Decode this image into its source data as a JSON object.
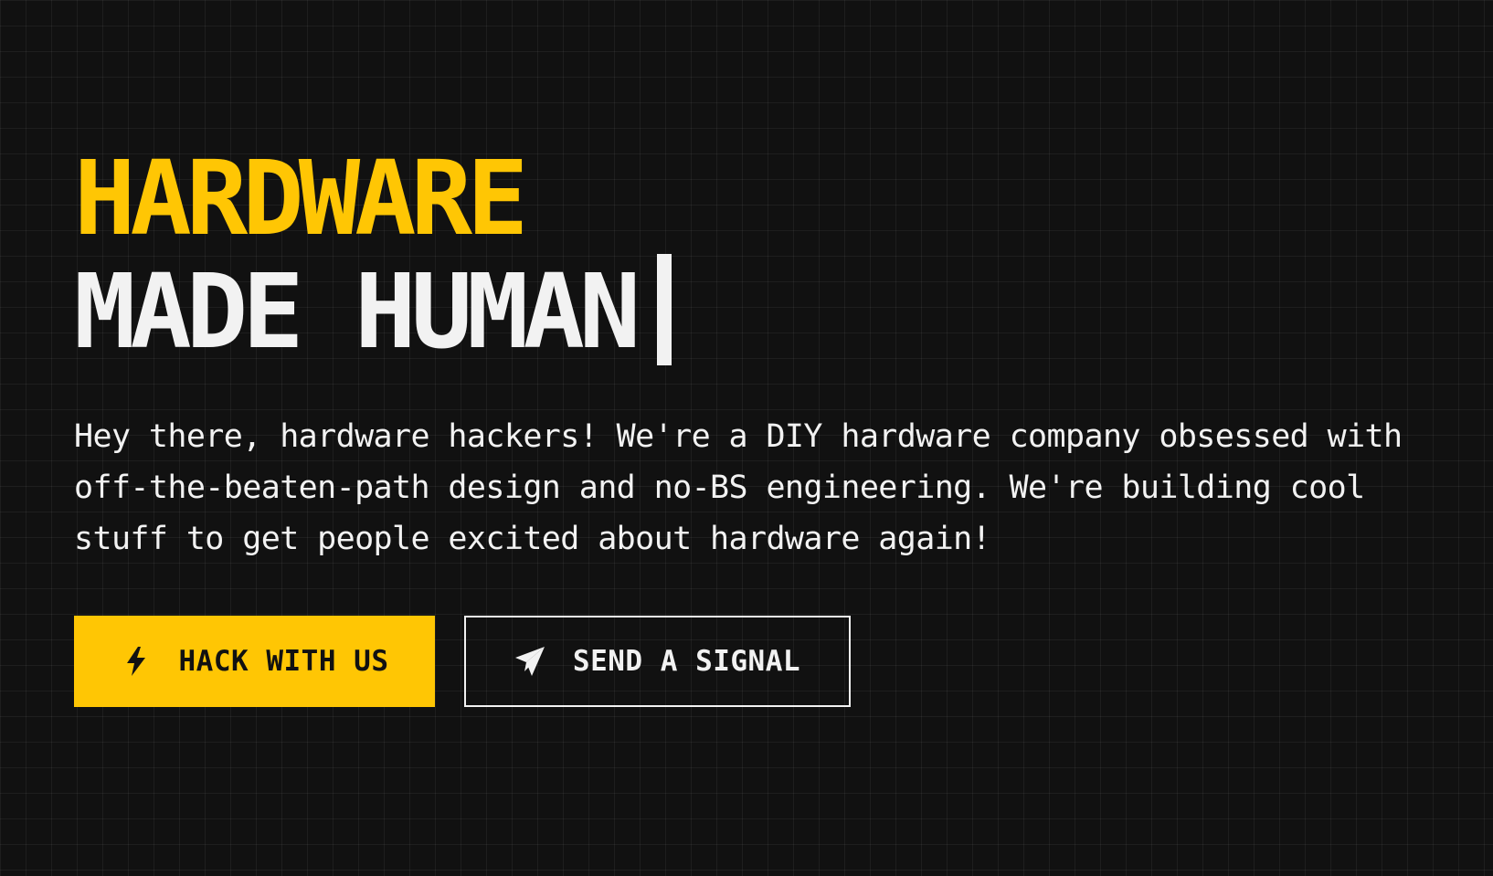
{
  "hero": {
    "headline_line1": "HARDWARE",
    "headline_line2": "MADE HUMAN",
    "intro": "Hey there, hardware hackers! We're a DIY hardware company obsessed with off-the-beaten-path design and no-BS engineering. We're building cool stuff to get people excited about hardware again!"
  },
  "actions": {
    "primary": {
      "label": "HACK WITH US",
      "icon": "lightning-bolt-icon"
    },
    "secondary": {
      "label": "SEND A SIGNAL",
      "icon": "paper-plane-icon"
    }
  },
  "colors": {
    "background": "#111111",
    "accent": "#ffc604",
    "text": "#f2f2f2",
    "grid_line": "#1f1f1f"
  }
}
